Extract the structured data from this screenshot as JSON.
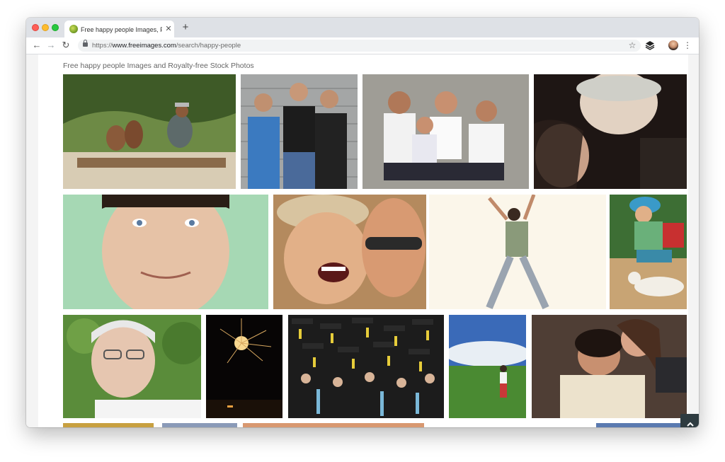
{
  "browser": {
    "tab_title": "Free happy people Images, Pictu",
    "tab_close_icon": "close-icon",
    "new_tab_label": "+",
    "url_prefix": "https://",
    "url_host": "www.freeimages.com",
    "url_path": "/search/happy-people",
    "icons": {
      "back": "arrow-left-icon",
      "forward": "arrow-right-icon",
      "reload": "reload-icon",
      "lock": "lock-icon",
      "bookmark": "star-icon",
      "extension": "layers-icon",
      "profile": "avatar",
      "menu": "kebab-menu-icon"
    }
  },
  "page": {
    "heading": "Free happy people Images and Royalty-free Stock Photos",
    "back_to_top_icon": "chevron-up-icon"
  },
  "photos": [
    {
      "name": "family-on-log",
      "colors": [
        "#5f7a3a",
        "#c8b79a"
      ]
    },
    {
      "name": "three-teens",
      "colors": [
        "#9ea0a0",
        "#2c2c2c"
      ]
    },
    {
      "name": "family-portrait",
      "colors": [
        "#b8b8b0",
        "#5a3d2e"
      ]
    },
    {
      "name": "close-faces-hat",
      "colors": [
        "#2a1e1a",
        "#e6d6c8"
      ]
    },
    {
      "name": "smiling-man-green",
      "colors": [
        "#a8d8b6",
        "#e8c4a8"
      ]
    },
    {
      "name": "laughing-women",
      "colors": [
        "#c89a6a",
        "#e8b888"
      ]
    },
    {
      "name": "jumping-man",
      "colors": [
        "#fbf6ea",
        "#7a8a7a"
      ]
    },
    {
      "name": "boy-with-dog",
      "colors": [
        "#3a7a3a",
        "#c8a878"
      ]
    },
    {
      "name": "old-man-smiling",
      "colors": [
        "#5a8a3a",
        "#e8d8c8"
      ]
    },
    {
      "name": "fireworks",
      "colors": [
        "#050505",
        "#e8c870"
      ]
    },
    {
      "name": "graduation-crowd",
      "colors": [
        "#202020",
        "#e8d040"
      ]
    },
    {
      "name": "girl-in-field",
      "colors": [
        "#3a6ab8",
        "#4a8a3a"
      ]
    },
    {
      "name": "couple-lying",
      "colors": [
        "#4a3a32",
        "#e8dcc8"
      ]
    }
  ],
  "accent": {
    "backtop_bg": "#2e3b40",
    "tabbar_bg": "#dee1e6"
  }
}
